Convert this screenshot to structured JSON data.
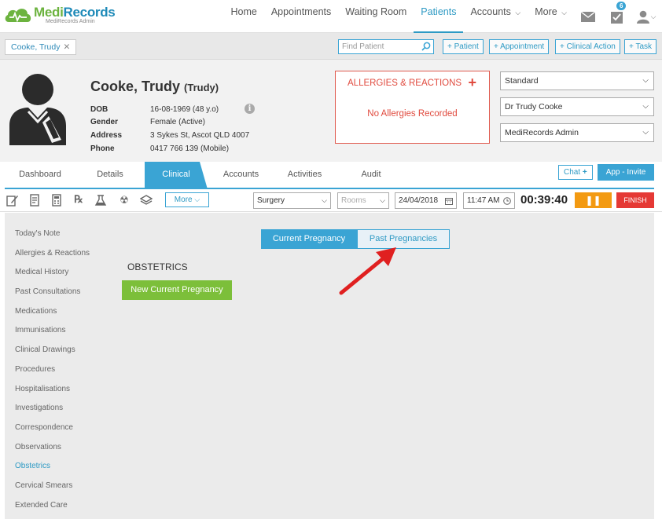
{
  "brand": {
    "name_part1": "Medi",
    "name_part2": "Records",
    "subtitle": "MediRecords Admin",
    "blue": "#1e8ab8",
    "green": "#6cb33f"
  },
  "nav": {
    "items": [
      {
        "label": "Home"
      },
      {
        "label": "Appointments"
      },
      {
        "label": "Waiting Room"
      },
      {
        "label": "Patients",
        "active": true
      },
      {
        "label": "Accounts",
        "dropdown": true
      },
      {
        "label": "More",
        "dropdown": true
      }
    ],
    "tasks_badge": "6"
  },
  "toolbar": {
    "open_patient": "Cooke, Trudy",
    "find_placeholder": "Find Patient",
    "buttons": [
      "+ Patient",
      "+ Appointment",
      "+ Clinical Action",
      "+ Task"
    ]
  },
  "patient": {
    "name": "Cooke, Trudy",
    "nickname": "(Trudy)",
    "fields": [
      {
        "label": "DOB",
        "value": "16-08-1969 (48 y.o)"
      },
      {
        "label": "Gender",
        "value": "Female (Active)"
      },
      {
        "label": "Address",
        "value": "3 Sykes St, Ascot QLD 4007"
      },
      {
        "label": "Phone",
        "value": "0417 766 139 (Mobile)"
      }
    ]
  },
  "allergies": {
    "title": "ALLERGIES & REACTIONS",
    "empty_text": "No Allergies Recorded"
  },
  "selects": {
    "billing": "Standard",
    "practitioner": "Dr Trudy Cooke",
    "location": "MediRecords Admin"
  },
  "tabs": [
    "Dashboard",
    "Details",
    "Clinical",
    "Accounts",
    "Activities",
    "Audit"
  ],
  "active_tab": "Clinical",
  "chat_label": "Chat",
  "invite_label": "App - Invite",
  "clinical_toolbar": {
    "more_label": "More",
    "site": "Surgery",
    "rooms_placeholder": "Rooms",
    "date": "24/04/2018",
    "time": "11:47 AM",
    "timer": "00:39:40",
    "pause_label": "❚❚",
    "finish_label": "FINISH"
  },
  "sidebar": [
    "Today's Note",
    "Allergies & Reactions",
    "Medical History",
    "Past Consultations",
    "Medications",
    "Immunisations",
    "Clinical Drawings",
    "Procedures",
    "Hospitalisations",
    "Investigations",
    "Correspondence",
    "Observations",
    "Obstetrics",
    "Cervical Smears",
    "Extended Care"
  ],
  "active_sidebar": "Obstetrics",
  "pregnancy": {
    "current_label": "Current Pregnancy",
    "past_label": "Past Pregnancies",
    "section_title": "OBSTETRICS",
    "new_button": "New Current Pregnancy"
  },
  "colors": {
    "accent": "#3aa4d4",
    "alert": "#e04a3e",
    "green_button": "#7cbf3a",
    "pause": "#f39a12",
    "finish": "#e53935",
    "annotation_arrow": "#e02020"
  }
}
